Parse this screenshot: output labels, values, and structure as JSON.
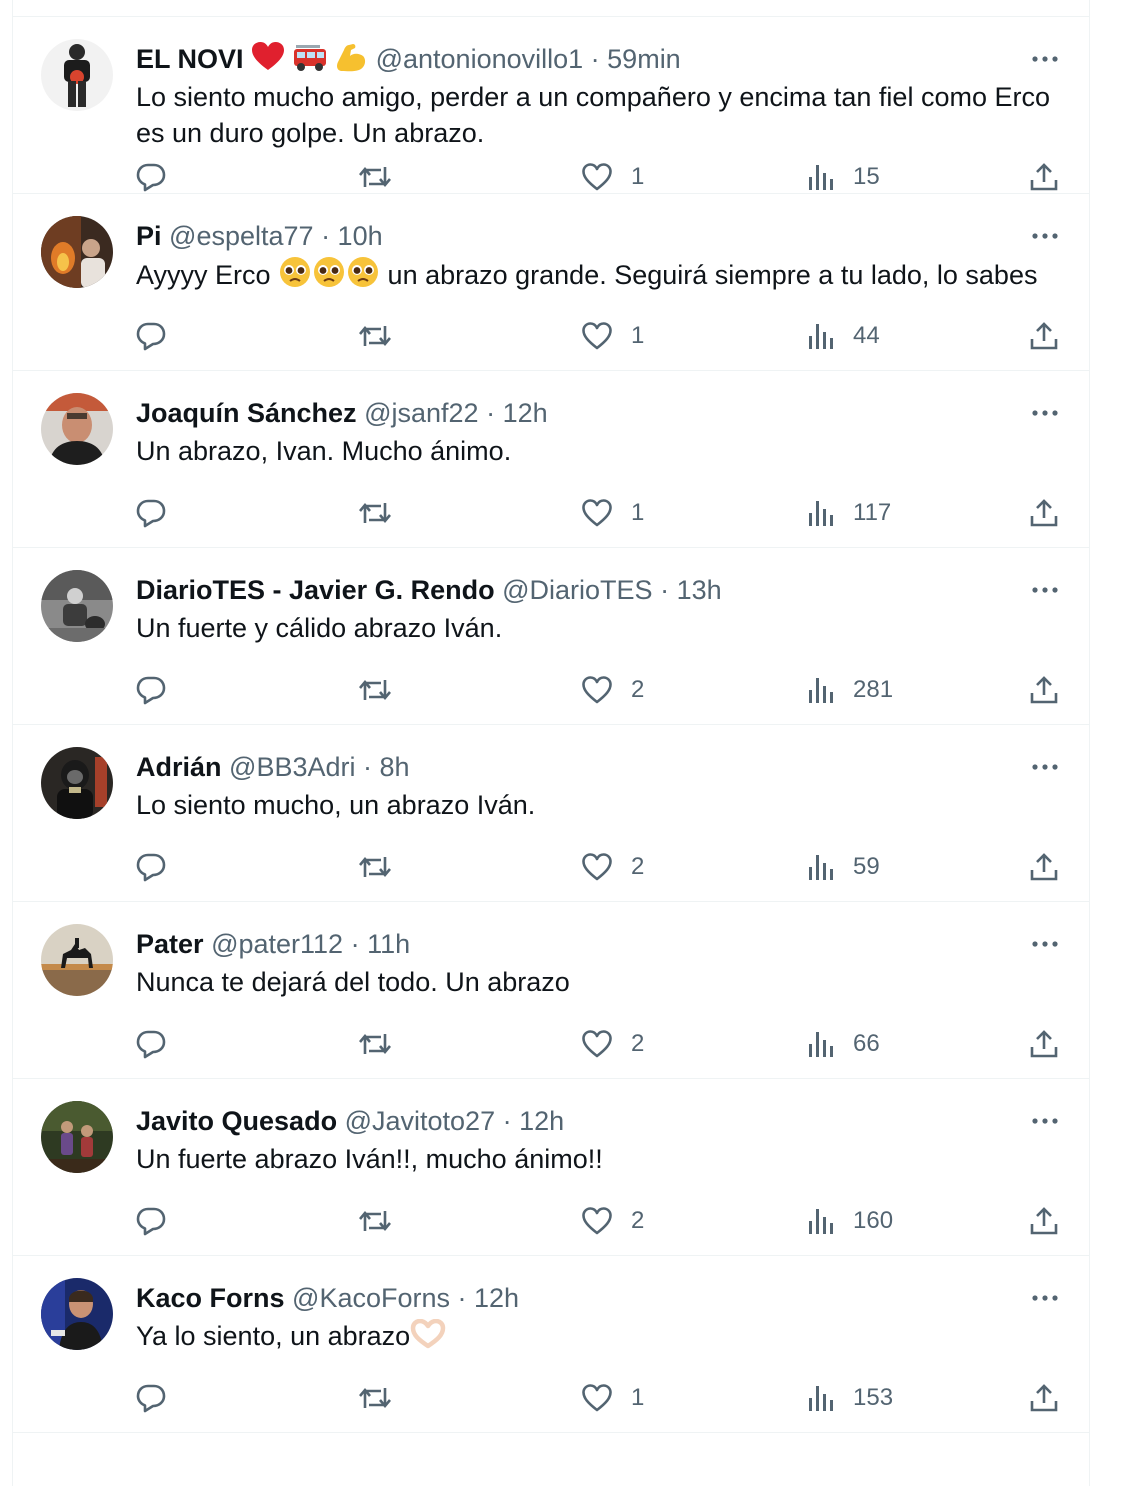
{
  "replies": [
    {
      "name": "EL NOVI",
      "name_emoji": [
        "red-heart",
        "fire-engine",
        "flexed-biceps"
      ],
      "handle": "@antonionovillo1",
      "time": "· 59min",
      "text": "Lo siento mucho amigo, perder a un compañero y encima tan fiel como Erco es un duro golpe. Un abrazo.",
      "likes": "1",
      "views": "15",
      "avatar": "man-in-black-shirt"
    },
    {
      "name": "Pi",
      "handle": "@espelta77",
      "time": "· 10h",
      "text_before": "Ayyyy Erco ",
      "text_emoji": [
        "pleading-face",
        "pleading-face",
        "pleading-face"
      ],
      "text_after": " un abrazo grande. Seguirá siempre a tu lado, lo sabes",
      "likes": "1",
      "views": "44",
      "avatar": "fireplace-photo"
    },
    {
      "name": "Joaquín Sánchez",
      "handle": "@jsanf22",
      "time": "· 12h",
      "text": "Un abrazo, Ivan. Mucho ánimo.",
      "likes": "1",
      "views": "117",
      "avatar": "man-portrait"
    },
    {
      "name": "DiarioTES - Javier G. Rendo",
      "handle": "@DiarioTES",
      "time": "· 13h",
      "text": "Un fuerte y cálido abrazo Iván.",
      "likes": "2",
      "views": "281",
      "avatar": "grayscale-outdoor-photo"
    },
    {
      "name": "Adrián",
      "handle": "@BB3Adri",
      "time": "· 8h",
      "text": "Lo siento mucho, un abrazo Iván.",
      "likes": "2",
      "views": "59",
      "avatar": "firefighter-gear"
    },
    {
      "name": "Pater",
      "handle": "@pater112",
      "time": "· 11h",
      "text": "Nunca te dejará del todo. Un abrazo",
      "likes": "2",
      "views": "66",
      "avatar": "camel-silhouette"
    },
    {
      "name": "Javito Quesado",
      "handle": "@Javitoto27",
      "time": "· 12h",
      "text": "Un fuerte abrazo Iván!!, mucho ánimo!!",
      "likes": "2",
      "views": "160",
      "avatar": "forest-hikers"
    },
    {
      "name": "Kaco Forns",
      "handle": "@KacoForns",
      "time": "· 12h",
      "text_before": "Ya lo siento, un abrazo",
      "text_emoji": [
        "heart-hands"
      ],
      "text_after": "",
      "likes": "1",
      "views": "153",
      "avatar": "speaker-on-stage"
    }
  ],
  "colors": {
    "text": "#0f1419",
    "secondary": "#536471",
    "divider": "#eff3f4"
  }
}
